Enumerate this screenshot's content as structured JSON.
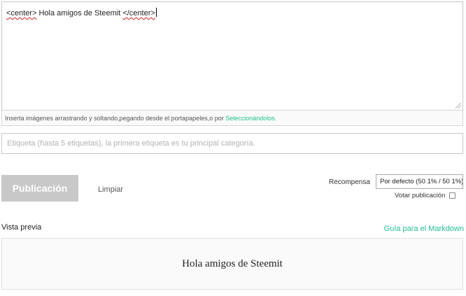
{
  "editor": {
    "content_open_tag": "<center>",
    "content_body": " Hola amigos de Steemit ",
    "content_close_tag": "</center>"
  },
  "upload_hint": {
    "text": "Inserta imágenes arrastrando y soltando,pegando desde el portapapeles,o por ",
    "link": "Seleccionándolos."
  },
  "tags": {
    "placeholder": "Etiqueta (hasta 5 etiquetas), la primera etiqueta es tu principal categoría.",
    "value": ""
  },
  "actions": {
    "publish_label": "Publicación",
    "clear_label": "Limpiar"
  },
  "reward": {
    "label": "Recompensa",
    "selected": "Por defecto (50 1% / 50 1%)"
  },
  "vote": {
    "label": "Votar publicación",
    "checked": false
  },
  "preview": {
    "label": "Vista previa",
    "markdown_link": "Guía para el Markdown",
    "rendered_text": "Hola amigos de Steemit"
  },
  "colors": {
    "accent": "#1fbf8f",
    "publish_disabled": "#c8c8c8"
  }
}
